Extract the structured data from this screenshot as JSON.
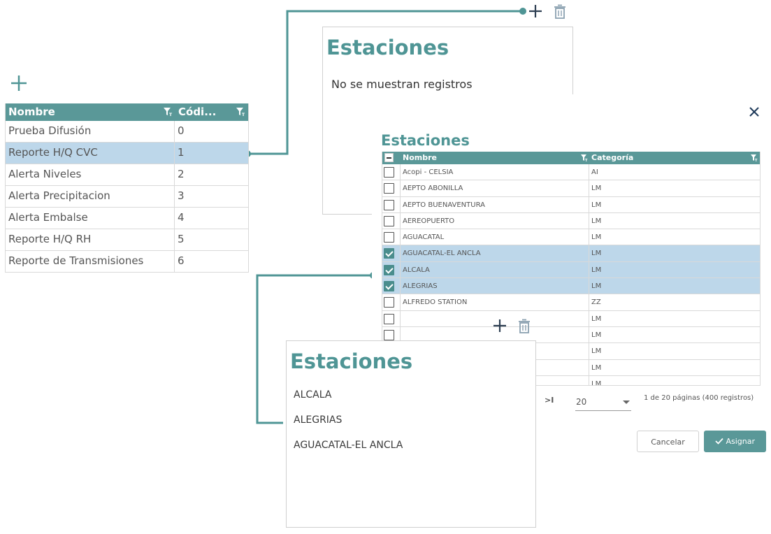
{
  "left_table": {
    "columns": [
      "Nombre",
      "Códi..."
    ],
    "rows": [
      {
        "nombre": "Prueba Difusión",
        "codigo": "0"
      },
      {
        "nombre": "Reporte H/Q CVC",
        "codigo": "1"
      },
      {
        "nombre": "Alerta Niveles",
        "codigo": "2"
      },
      {
        "nombre": "Alerta Precipitacion",
        "codigo": "3"
      },
      {
        "nombre": "Alerta Embalse",
        "codigo": "4"
      },
      {
        "nombre": "Reporte H/Q RH",
        "codigo": "5"
      },
      {
        "nombre": "Reporte de Transmisiones",
        "codigo": "6"
      }
    ],
    "selected_row": 1
  },
  "top_panel": {
    "title": "Estaciones",
    "empty_text": "No se muestran registros"
  },
  "modal": {
    "title": "Estaciones",
    "columns": [
      "Nombre",
      "Categoría"
    ],
    "rows": [
      {
        "nombre": "Acopi - CELSIA",
        "categoria": "AI",
        "checked": false
      },
      {
        "nombre": "AEPTO ABONILLA",
        "categoria": "LM",
        "checked": false
      },
      {
        "nombre": "AEPTO BUENAVENTURA",
        "categoria": "LM",
        "checked": false
      },
      {
        "nombre": "AEREOPUERTO",
        "categoria": "LM",
        "checked": false
      },
      {
        "nombre": "AGUACATAL",
        "categoria": "LM",
        "checked": false
      },
      {
        "nombre": "AGUACATAL-EL ANCLA",
        "categoria": "LM",
        "checked": true
      },
      {
        "nombre": "ALCALA",
        "categoria": "LM",
        "checked": true
      },
      {
        "nombre": "ALEGRIAS",
        "categoria": "LM",
        "checked": true
      },
      {
        "nombre": "ALFREDO STATION",
        "categoria": "ZZ",
        "checked": false
      },
      {
        "nombre": "",
        "categoria": "LM",
        "checked": false
      },
      {
        "nombre": "",
        "categoria": "LM",
        "checked": false
      },
      {
        "nombre": "",
        "categoria": "LM",
        "checked": false
      },
      {
        "nombre": "",
        "categoria": "LM",
        "checked": false
      },
      {
        "nombre": "",
        "categoria": "LM",
        "checked": false
      }
    ],
    "pager": {
      "last_label": ">I",
      "page_size": "20",
      "info": "1 de 20 páginas (400 registros)"
    },
    "cancel_label": "Cancelar",
    "assign_label": "Asignar"
  },
  "bottom_panel": {
    "title": "Estaciones",
    "items": [
      "ALCALA",
      "ALEGRIAS",
      "AGUACATAL-EL ANCLA"
    ]
  },
  "colors": {
    "teal": "#5a9898",
    "selection": "#bdd7ea"
  },
  "icons": {
    "add": "plus-icon",
    "delete": "trash-icon",
    "filter": "filter-icon",
    "close": "close-icon",
    "check": "check-icon"
  }
}
